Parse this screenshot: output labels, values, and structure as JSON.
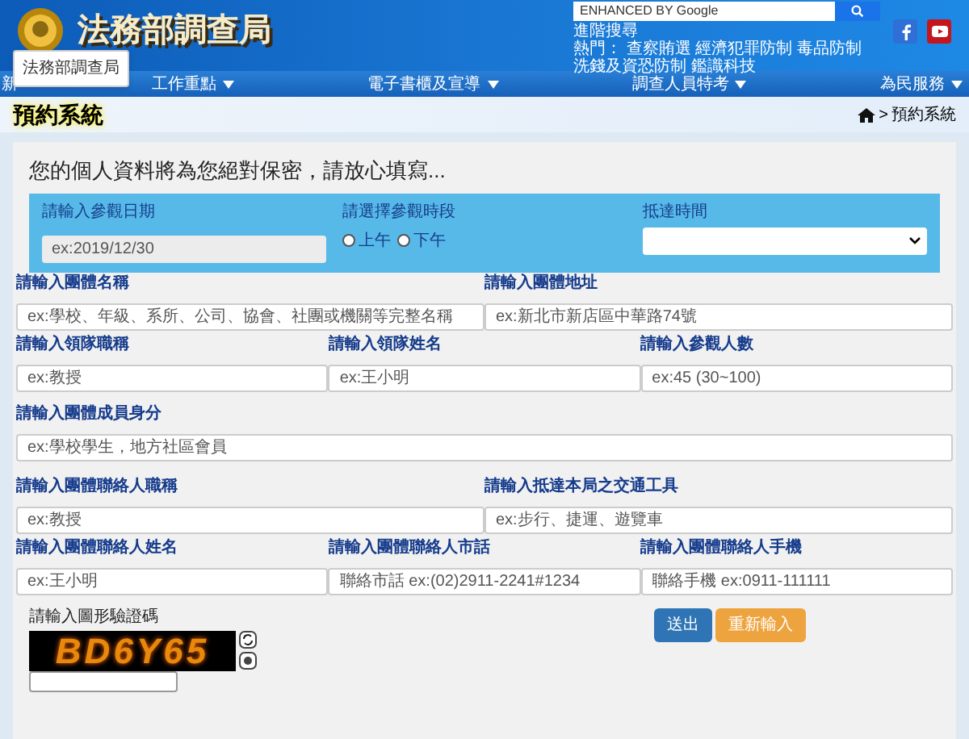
{
  "header": {
    "site_title": "法務部調查局",
    "search": {
      "placeholder": "ENHANCED BY Google"
    },
    "advanced_search": "進階搜尋",
    "hot_label": "熱門：",
    "hot_links": [
      "查察賄選",
      "經濟犯罪防制",
      "毒品防制",
      "洗錢及資恐防制",
      "鑑識科技"
    ],
    "tooltip": "法務部調查局"
  },
  "nav": [
    {
      "label": "新",
      "dropdown": false
    },
    {
      "label": "工作重點",
      "dropdown": true
    },
    {
      "label": "電子書櫃及宣導",
      "dropdown": true
    },
    {
      "label": "調查人員特考",
      "dropdown": true
    },
    {
      "label": "為民服務",
      "dropdown": true
    }
  ],
  "page_title": "預約系統",
  "breadcrumb": {
    "separator": ">",
    "current": "預約系統"
  },
  "form": {
    "notice": "您的個人資料將為您絕對保密，請放心填寫...",
    "visit_date": {
      "label": "請輸入參觀日期",
      "placeholder": "ex:2019/12/30"
    },
    "period": {
      "label": "請選擇參觀時段",
      "options": [
        {
          "label": "上午",
          "selected": false
        },
        {
          "label": "下午",
          "selected": false
        }
      ]
    },
    "arrival_time": {
      "label": "抵達時間"
    },
    "rows": [
      [
        {
          "label": "請輸入團體名稱",
          "placeholder": "ex:學校、年級、系所、公司、協會、社團或機關等完整名稱"
        },
        {
          "label": "請輸入團體地址",
          "placeholder": "ex:新北市新店區中華路74號"
        }
      ],
      [
        {
          "label": "請輸入領隊職稱",
          "placeholder": "ex:教授"
        },
        {
          "label": "請輸入領隊姓名",
          "placeholder": "ex:王小明"
        },
        {
          "label": "請輸入參觀人數",
          "placeholder": "ex:45 (30~100)"
        }
      ],
      [
        {
          "label": "請輸入團體成員身分",
          "placeholder": "ex:學校學生，地方社區會員"
        }
      ],
      [
        {
          "label": "請輸入團體聯絡人職稱",
          "placeholder": "ex:教授"
        },
        {
          "label": "請輸入抵達本局之交通工具",
          "placeholder": "ex:步行、捷運、遊覽車"
        }
      ],
      [
        {
          "label": "請輸入團體聯絡人姓名",
          "placeholder": "ex:王小明"
        },
        {
          "label": "請輸入團體聯絡人市話",
          "placeholder": "聯絡市話 ex:(02)2911-2241#1234"
        },
        {
          "label": "請輸入團體聯絡人手機",
          "placeholder": "聯絡手機 ex:0911-111111"
        }
      ]
    ],
    "captcha": {
      "label": "請輸入圖形驗證碼",
      "code": "BD6Y65"
    },
    "buttons": {
      "submit": "送出",
      "reset": "重新輸入"
    }
  }
}
